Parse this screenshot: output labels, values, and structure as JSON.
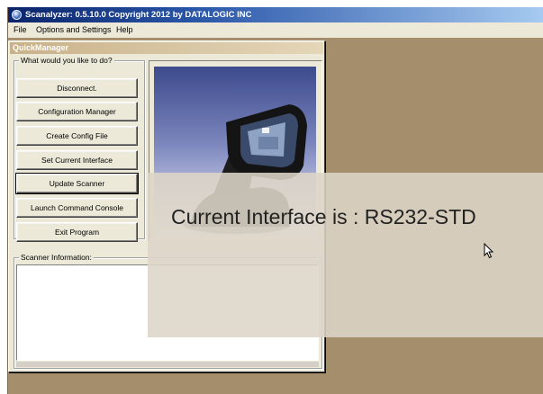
{
  "window": {
    "title": "Scanalyzer: 0.5.10.0  Copyright 2012 by DATALOGIC INC",
    "icon": "scanalyzer-app-icon"
  },
  "menu": {
    "items": [
      "File",
      "Options and Settings",
      "Help"
    ]
  },
  "quick_manager": {
    "title": "QuickManager",
    "actions_group_label": "What would you like to do?",
    "buttons": [
      "Disconnect.",
      "Configuration Manager",
      "Create Config File",
      "Set Current Interface",
      "Update Scanner",
      "Launch Command Console",
      "Exit Program"
    ],
    "focused_button": "Update Scanner",
    "info_group_label": "Scanner Information:",
    "info_text": ""
  },
  "overlay": {
    "message": "Current Interface is : RS232-STD"
  },
  "colors": {
    "desktop": "#a48e6c",
    "dialog": "#ece9d8",
    "titlebar_start": "#0a246a",
    "overlay": "#ddd5c7"
  }
}
